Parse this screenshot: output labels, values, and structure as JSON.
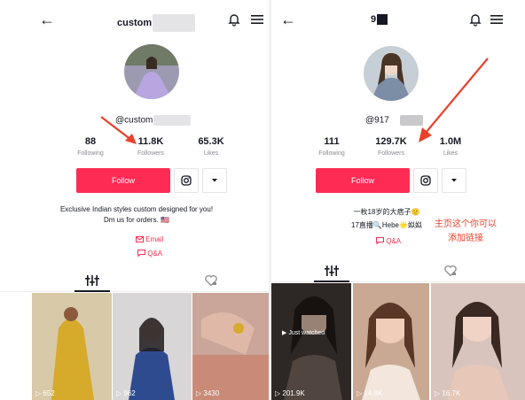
{
  "left": {
    "header": {
      "username": "custom"
    },
    "handle": "@custom",
    "stats": [
      {
        "value": "88",
        "label": "Following"
      },
      {
        "value": "11.8K",
        "label": "Followers"
      },
      {
        "value": "65.3K",
        "label": "Likes"
      }
    ],
    "follow_label": "Follow",
    "bio": "Exclusive Indian styles custom designed for you! Dm us for orders. 🇺🇸",
    "links": [
      "Email",
      "Q&A"
    ],
    "videos": [
      {
        "views": "652"
      },
      {
        "views": "962"
      },
      {
        "views": "3430"
      }
    ]
  },
  "right": {
    "header": {
      "username": "9"
    },
    "handle": "@917",
    "stats": [
      {
        "value": "111",
        "label": "Following"
      },
      {
        "value": "129.7K",
        "label": "Followers"
      },
      {
        "value": "1.0M",
        "label": "Likes"
      }
    ],
    "follow_label": "Follow",
    "bio_line1": "一枚18岁的大痞子🙂",
    "bio_line2": "17直播🔍Hebe🌟姒姒",
    "annotation_line1": "主页这个你可以",
    "annotation_line2": "添加链接",
    "links": [
      "Q&A"
    ],
    "just_watched": "Just watched",
    "videos": [
      {
        "views": "201.9K"
      },
      {
        "views": "14.8K"
      },
      {
        "views": "16.7K"
      }
    ]
  },
  "colors": {
    "accent": "#fe2c55",
    "arrow": "#e8412c",
    "text": "#161823",
    "muted": "#8a8b91"
  },
  "icons": [
    "back-arrow-icon",
    "bell-icon",
    "menu-icon",
    "instagram-icon",
    "dropdown-icon",
    "email-icon",
    "qa-icon",
    "videos-tab-icon",
    "liked-tab-icon",
    "play-icon"
  ]
}
